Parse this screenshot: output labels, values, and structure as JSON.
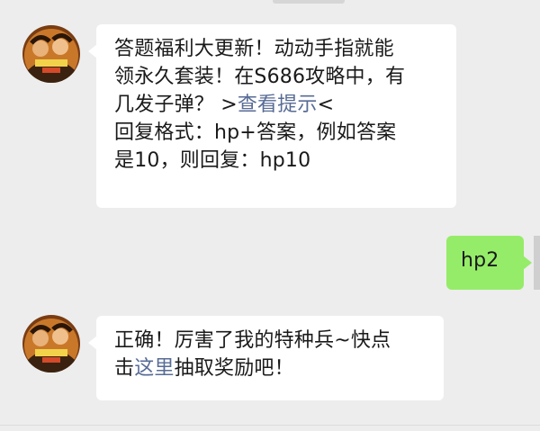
{
  "chat": {
    "messages": [
      {
        "sender": "official-account",
        "avatar_icon": "game-character-avatar-icon",
        "lines": [
          {
            "text": "答题福利大更新！动动手指就能"
          },
          {
            "text": "领永久套装！在S686攻略中，有"
          },
          {
            "before": "几发子弹？ >",
            "link": "查看提示",
            "after": "<"
          },
          {
            "text": "回复格式：hp+答案，例如答案"
          },
          {
            "text": "是10，则回复：hp10"
          }
        ]
      },
      {
        "sender": "me",
        "text": "hp2"
      },
      {
        "sender": "official-account",
        "avatar_icon": "game-character-avatar-icon",
        "lines": [
          {
            "text": "正确！厉害了我的特种兵~快点"
          },
          {
            "before": "击",
            "link": "这里",
            "after": "抽取奖励吧！"
          }
        ]
      }
    ]
  },
  "colors": {
    "background": "#ededed",
    "incoming_bubble": "#ffffff",
    "outgoing_bubble": "#95ec69",
    "link": "#576b95"
  }
}
